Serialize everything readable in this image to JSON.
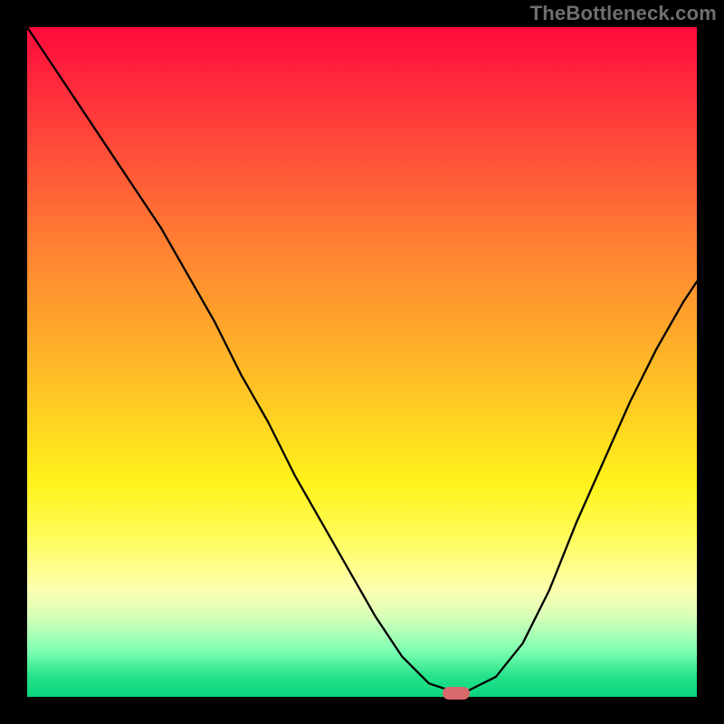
{
  "watermark": {
    "text": "TheBottleneck.com"
  },
  "chart_data": {
    "type": "line",
    "title": "",
    "xlabel": "",
    "ylabel": "",
    "xlim": [
      0,
      100
    ],
    "ylim": [
      0,
      100
    ],
    "grid": false,
    "legend": false,
    "background": {
      "gradient_direction": "vertical",
      "meaning": "top = high bottleneck (red), bottom = low bottleneck (green)",
      "stops": [
        {
          "pos": 0.0,
          "color": "#ff0a3c"
        },
        {
          "pos": 0.22,
          "color": "#ff5a38"
        },
        {
          "pos": 0.46,
          "color": "#ffaa2a"
        },
        {
          "pos": 0.68,
          "color": "#fff21a"
        },
        {
          "pos": 0.84,
          "color": "#fdffb0"
        },
        {
          "pos": 0.93,
          "color": "#7fffb2"
        },
        {
          "pos": 1.0,
          "color": "#0bd47d"
        }
      ]
    },
    "series": [
      {
        "name": "bottleneck-curve",
        "x": [
          0,
          4,
          8,
          12,
          16,
          20,
          24,
          28,
          32,
          36,
          40,
          44,
          48,
          52,
          56,
          60,
          63,
          66,
          70,
          74,
          78,
          82,
          86,
          90,
          94,
          98,
          100
        ],
        "y": [
          100,
          94,
          88,
          82,
          76,
          70,
          63,
          56,
          48,
          41,
          33,
          26,
          19,
          12,
          6,
          2,
          1,
          1,
          3,
          8,
          16,
          26,
          35,
          44,
          52,
          59,
          62
        ]
      }
    ],
    "marker": {
      "name": "optimal-point",
      "x": 64,
      "y": 0.5,
      "color": "#d96a6e",
      "shape": "pill"
    }
  }
}
